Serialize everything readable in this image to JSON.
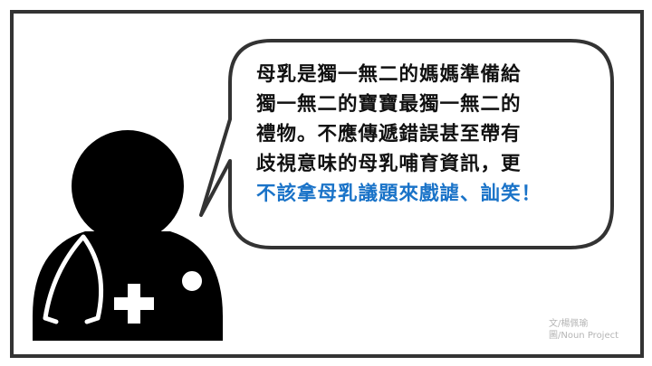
{
  "bubble": {
    "lines": [
      "母乳是獨一無二的媽媽準備給",
      "獨一無二的寶寶最獨一無二的",
      "禮物。不應傳遞錯誤甚至帶有",
      "歧視意味的母乳哺育資訊，更"
    ],
    "highlight_line": "不該拿母乳議題來戲謔、訕笑！",
    "highlight_color": "#1a73c8",
    "text_color": "#111111"
  },
  "credits": {
    "author": "文/楊佩瑜",
    "image": "圖/Noun Project"
  },
  "icons": {
    "doctor": "doctor-with-stethoscope-icon",
    "cross": "medical-cross-icon"
  }
}
